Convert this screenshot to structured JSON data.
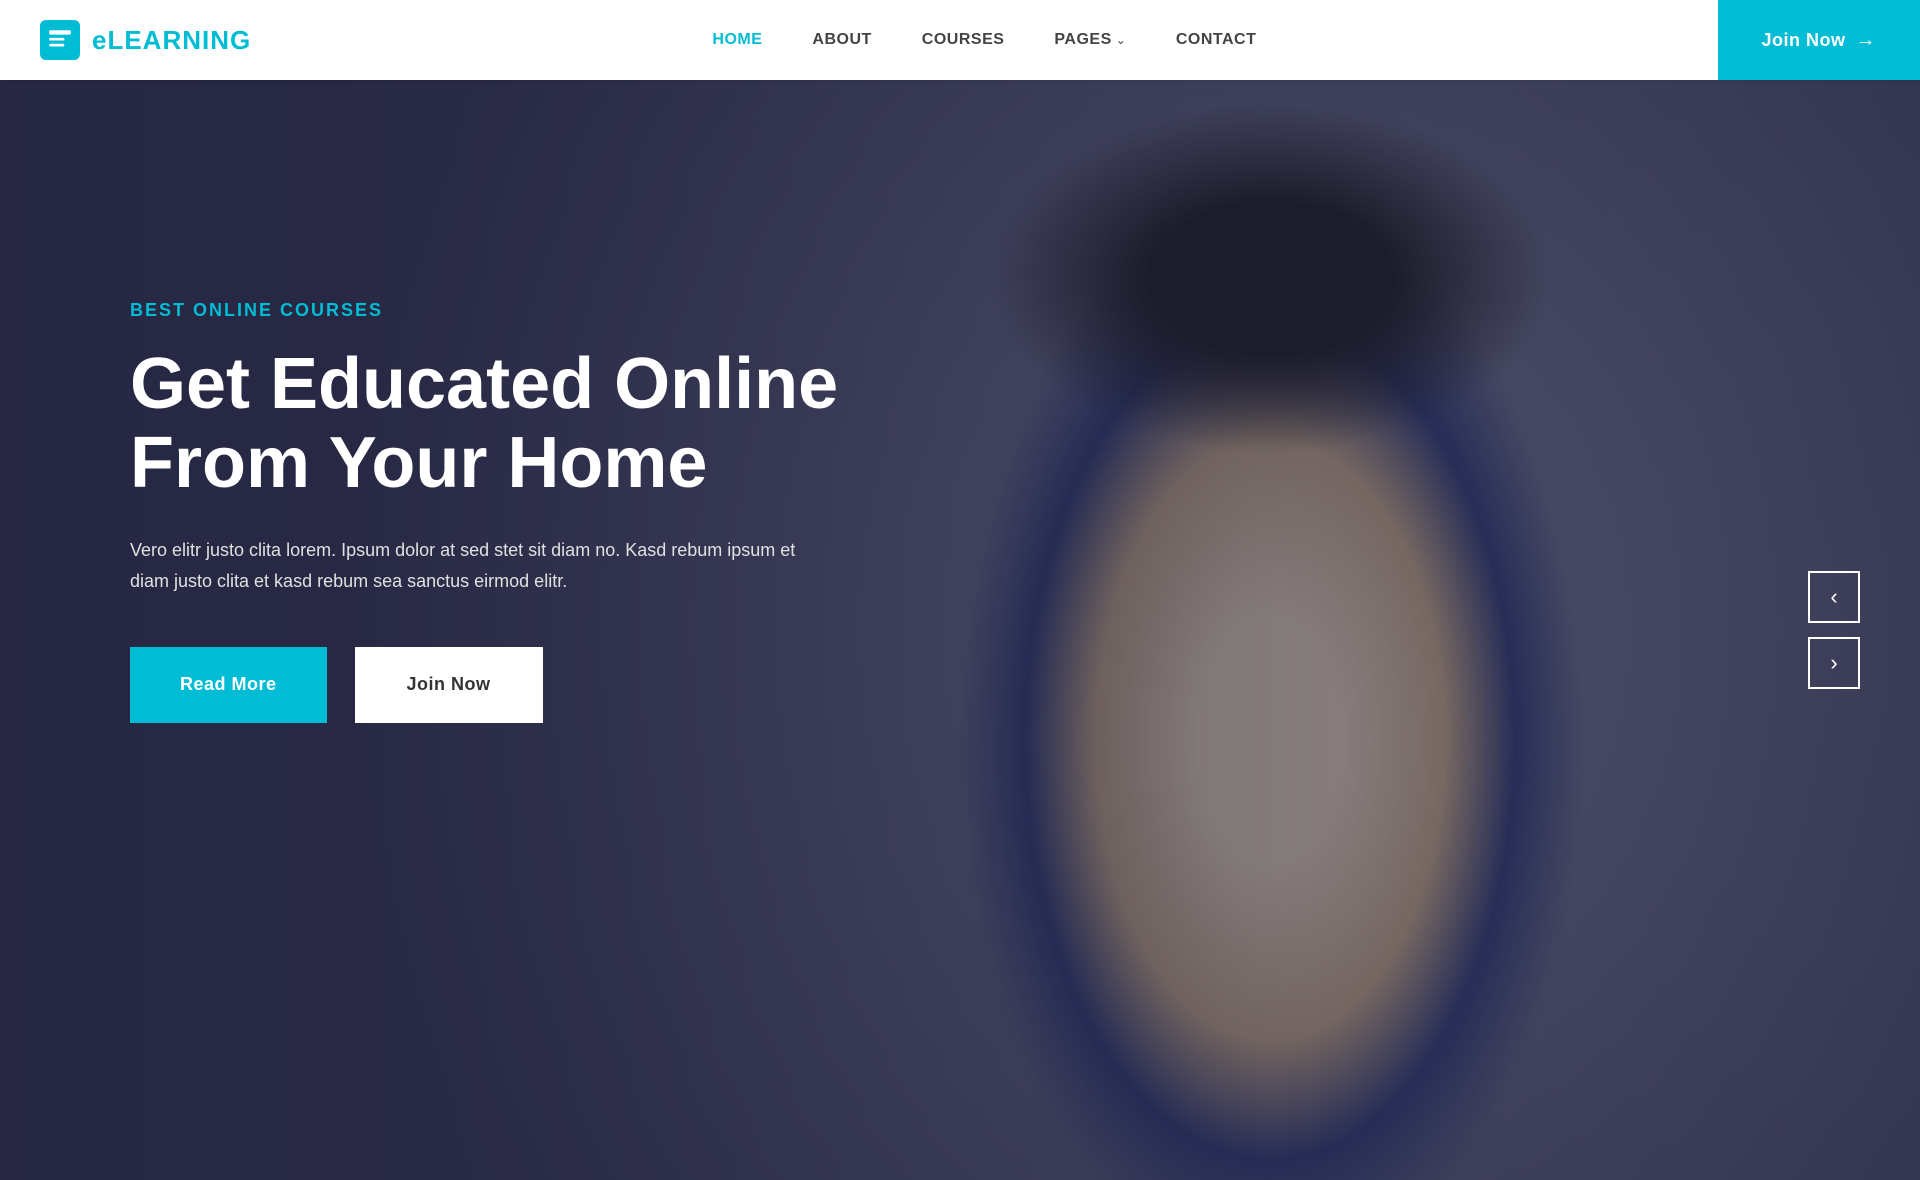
{
  "brand": {
    "name": "eLEARNING"
  },
  "navbar": {
    "links": [
      {
        "id": "home",
        "label": "HOME",
        "active": true
      },
      {
        "id": "about",
        "label": "ABOUT",
        "active": false
      },
      {
        "id": "courses",
        "label": "COURSES",
        "active": false
      },
      {
        "id": "pages",
        "label": "PAGES",
        "active": false,
        "hasDropdown": true
      },
      {
        "id": "contact",
        "label": "CONTACT",
        "active": false
      }
    ],
    "join_btn": "Join Now"
  },
  "hero": {
    "subtitle": "BEST ONLINE COURSES",
    "title_line1": "Get Educated Online",
    "title_line2": "From Your Home",
    "description": "Vero elitr justo clita lorem. Ipsum dolor at sed stet sit diam no. Kasd rebum ipsum et diam justo clita et kasd rebum sea sanctus eirmod elitr.",
    "btn_read_more": "Read More",
    "btn_join_now": "Join Now"
  },
  "slider": {
    "prev_label": "‹",
    "next_label": "›"
  },
  "colors": {
    "accent": "#00bcd4",
    "white": "#ffffff",
    "dark": "#333333"
  }
}
